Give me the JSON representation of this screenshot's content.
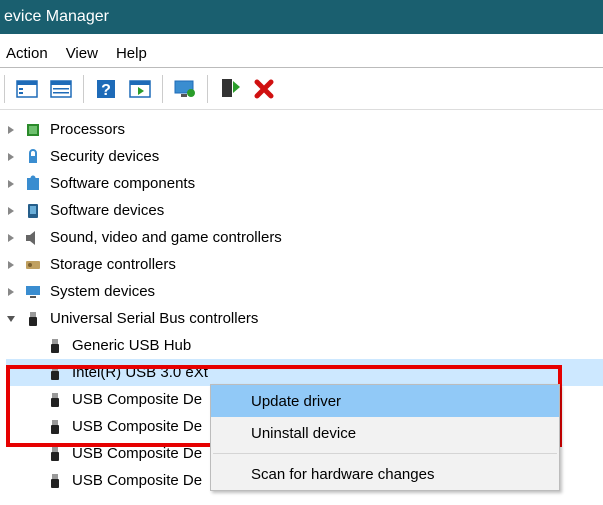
{
  "titlebar": {
    "text": "evice Manager"
  },
  "menubar": {
    "action": "Action",
    "view": "View",
    "help": "Help"
  },
  "tree": {
    "categories": [
      {
        "label": "Processors"
      },
      {
        "label": "Security devices"
      },
      {
        "label": "Software components"
      },
      {
        "label": "Software devices"
      },
      {
        "label": "Sound, video and game controllers"
      },
      {
        "label": "Storage controllers"
      },
      {
        "label": "System devices"
      },
      {
        "label": "Universal Serial Bus controllers"
      }
    ],
    "usb_children": [
      {
        "label": "Generic USB Hub"
      },
      {
        "label": "Intel(R) USB 3.0 eXt"
      },
      {
        "label": "USB Composite De"
      },
      {
        "label": "USB Composite De"
      },
      {
        "label": "USB Composite De"
      },
      {
        "label": "USB Composite De"
      }
    ]
  },
  "context_menu": {
    "update": "Update driver",
    "uninstall": "Uninstall device",
    "scan": "Scan for hardware changes"
  }
}
